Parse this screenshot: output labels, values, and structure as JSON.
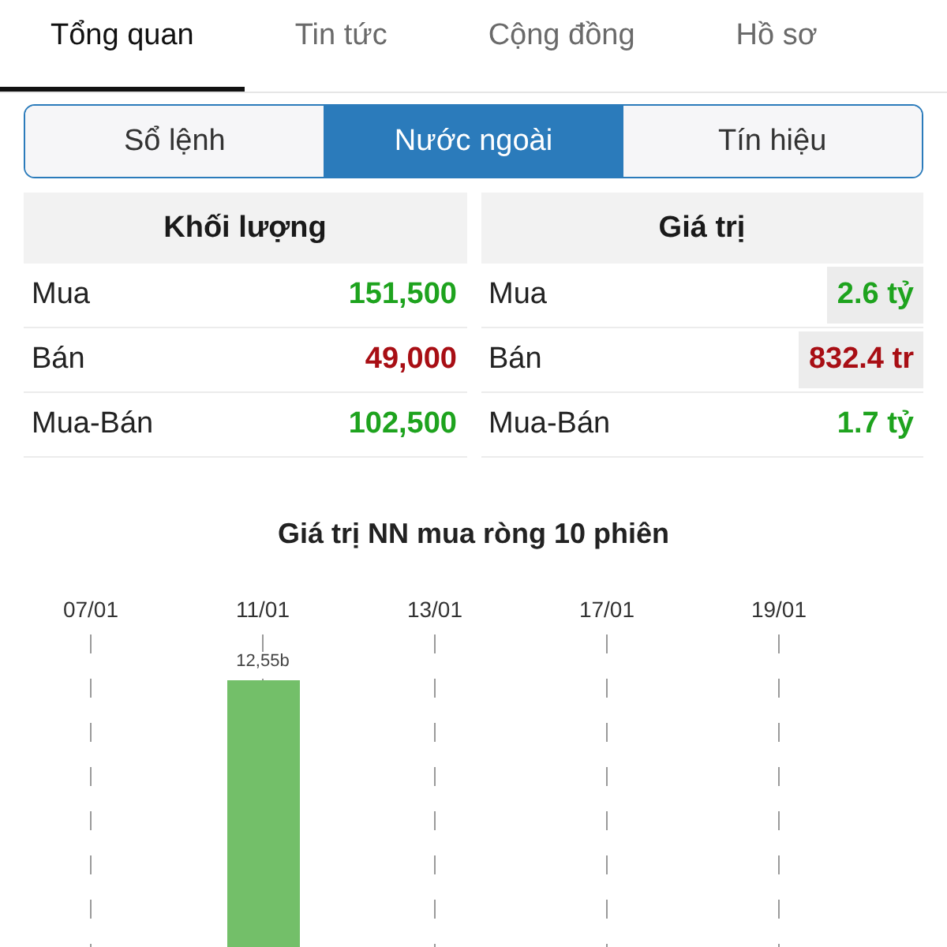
{
  "tabs": [
    {
      "label": "Tổng quan",
      "selected": true
    },
    {
      "label": "Tin tức",
      "selected": false
    },
    {
      "label": "Cộng đồng",
      "selected": false
    },
    {
      "label": "Hồ sơ",
      "selected": false
    }
  ],
  "segments": [
    {
      "label": "Sổ lệnh",
      "selected": false
    },
    {
      "label": "Nước ngoài",
      "selected": true
    },
    {
      "label": "Tín hiệu",
      "selected": false
    }
  ],
  "tables": [
    {
      "heading": "Khối lượng",
      "rows": [
        {
          "label": "Mua",
          "value": "151,500",
          "color": "#1ea31e",
          "highlighted": false
        },
        {
          "label": "Bán",
          "value": "49,000",
          "color": "#a80e14",
          "highlighted": false
        },
        {
          "label": "Mua-Bán",
          "value": "102,500",
          "color": "#1ea31e",
          "highlighted": false
        }
      ]
    },
    {
      "heading": "Giá trị",
      "rows": [
        {
          "label": "Mua",
          "value": "2.6 tỷ",
          "color": "#1ea31e",
          "highlighted": true
        },
        {
          "label": "Bán",
          "value": "832.4 tr",
          "color": "#a80e14",
          "highlighted": true
        },
        {
          "label": "Mua-Bán",
          "value": "1.7 tỷ",
          "color": "#1ea31e",
          "highlighted": false
        }
      ]
    }
  ],
  "chart": {
    "title": "Giá trị NN mua ròng 10 phiên",
    "dates": [
      {
        "label": "07/01"
      },
      {
        "label": "11/01",
        "bar_label": "12,55b"
      },
      {
        "label": "13/01"
      },
      {
        "label": "17/01"
      },
      {
        "label": "19/01"
      }
    ]
  }
}
